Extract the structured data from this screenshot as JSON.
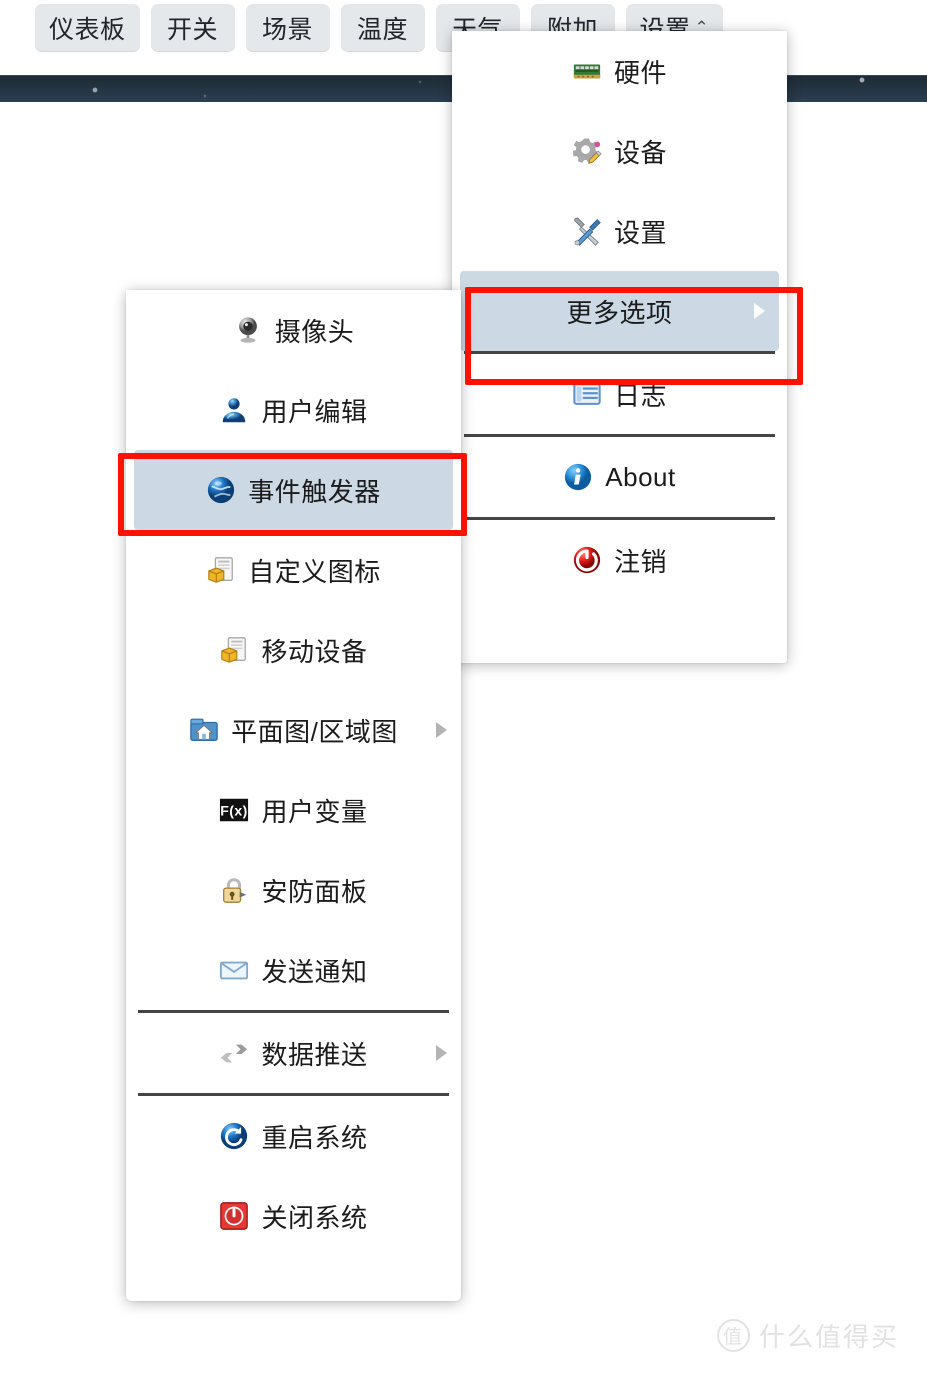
{
  "header": {
    "tabs": [
      {
        "label": "仪表板",
        "icon": "none"
      },
      {
        "label": "开关",
        "icon": "none"
      },
      {
        "label": "场景",
        "icon": "none"
      },
      {
        "label": "温度",
        "icon": "none"
      },
      {
        "label": "天气",
        "icon": "none"
      },
      {
        "label": "附加",
        "icon": "none"
      },
      {
        "label": "设置",
        "icon": "chevron-up-icon",
        "chevron": "⌃",
        "active": true
      }
    ]
  },
  "settings_menu": {
    "items": [
      {
        "label": "硬件",
        "icon": "circuit-board-icon"
      },
      {
        "label": "设备",
        "icon": "gear-pencil-icon"
      },
      {
        "label": "设置",
        "icon": "tools-icon"
      },
      {
        "label": "更多选项",
        "icon": "none",
        "selected": true,
        "has_submenu": true,
        "arrow": "▶"
      },
      {
        "label": "日志",
        "icon": "list-icon"
      },
      {
        "label": "About",
        "icon": "info-icon"
      },
      {
        "label": "注销",
        "icon": "power-logout-icon"
      }
    ]
  },
  "more_options_menu": {
    "items": [
      {
        "label": "摄像头",
        "icon": "webcam-icon"
      },
      {
        "label": "用户编辑",
        "icon": "user-icon"
      },
      {
        "label": "事件触发器",
        "icon": "globe-icon",
        "selected": true
      },
      {
        "label": "自定义图标",
        "icon": "package-icon"
      },
      {
        "label": "移动设备",
        "icon": "package-icon"
      },
      {
        "label": "平面图/区域图",
        "icon": "house-icon",
        "has_submenu": true,
        "arrow": "▶"
      },
      {
        "label": "用户变量",
        "icon": "fx-icon"
      },
      {
        "label": "安防面板",
        "icon": "lock-icon"
      },
      {
        "label": "发送通知",
        "icon": "envelope-icon"
      },
      {
        "label": "数据推送",
        "icon": "transfer-arrows-icon",
        "has_submenu": true,
        "arrow": "▶"
      },
      {
        "label": "重启系统",
        "icon": "restart-icon"
      },
      {
        "label": "关闭系统",
        "icon": "shutdown-icon"
      }
    ]
  },
  "annotations": [
    {
      "name": "highlight-more-options",
      "color": "#fb1202"
    },
    {
      "name": "highlight-event-trigger",
      "color": "#fb1202"
    }
  ],
  "watermark": {
    "logo_text": "值",
    "text": "什么值得买"
  },
  "colors": {
    "selected_item_bg": "#ccd9e4",
    "annotation_red": "#fb1202",
    "header_top": "#606f7e",
    "header_band": "#253645",
    "tab_bg": "#e1e5e8",
    "divider": "#454545"
  }
}
